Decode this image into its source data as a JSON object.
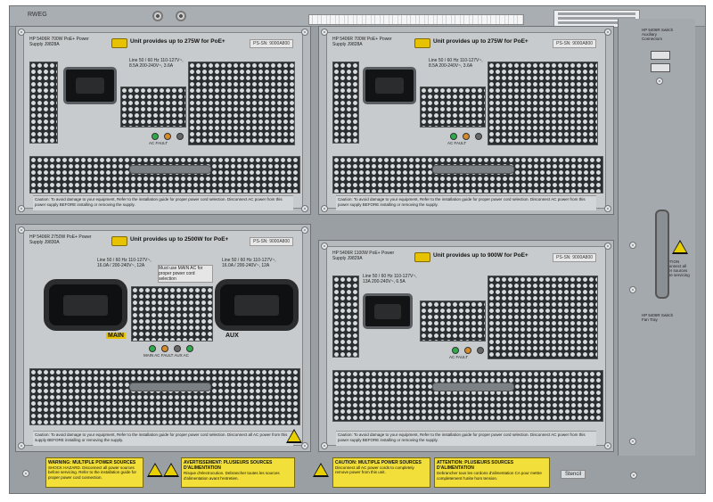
{
  "chassis": {
    "model": "RWEG",
    "brand_tag": "Stencil"
  },
  "psu1": {
    "title": "HP 5406R 700W PoE+ Power Supply J9828A",
    "note": "Unit provides up to 275W for PoE+",
    "part": "PS-SN: 9000A800",
    "rating": "Line 50 / 60 Hz 110-127V~, 8.5A 200-240V~, 3.6A",
    "led_labels": "AC   FAULT",
    "caution": "Caution: To avoid damage to your equipment, Refer to the installation guide for proper power cord selection. Disconnect AC power from this power supply BEFORE installing or removing the supply."
  },
  "psu2": {
    "title": "HP 5406R 700W PoE+ Power Supply J9828A",
    "note": "Unit provides up to 275W for PoE+",
    "part": "PS-SN: 9000A800",
    "rating": "Line 50 / 60 Hz 110-127V~, 8.5A 200-240V~, 3.6A",
    "led_labels": "AC   FAULT",
    "caution": "Caution: To avoid damage to your equipment, Refer to the installation guide for proper power cord selection. Disconnect AC power from this power supply BEFORE installing or removing the supply."
  },
  "psu3": {
    "title": "HP 5406R 2750W PoE+ Power Supply J9830A",
    "note": "Unit provides up to 2500W for PoE+",
    "part": "PS-SN: 9000A800",
    "rating_main": "Line 50 / 60 Hz 110-127V~, 16.0A / 200-240V~, 12A",
    "rating_aux": "Line 50 / 60 Hz 110-127V~, 16.0A / 200-240V~, 12A",
    "aux_note": "Must use MAIN AC for proper power cord selection",
    "main_label": "MAIN",
    "aux_label": "AUX",
    "led_labels": "MAIN AC   FAULT   AUX AC",
    "caution": "Caution: To avoid damage to your equipment, Refer to the installation guide for proper power cord selection. Disconnect all AC power from this supply BEFORE installing or removing the supply."
  },
  "psu4": {
    "title": "HP 5406R 1100W PoE+ Power Supply J9829A",
    "note": "Unit provides up to 900W for PoE+",
    "part": "PS-SN: 9000A800",
    "rating": "Line 50 / 60 Hz 110-127V~, 13A 200-240V~, 6.5A",
    "led_labels": "AC   FAULT",
    "caution": "Caution: To avoid damage to your equipment, Refer to the installation guide for proper power cord selection. Disconnect AC power from this power supply BEFORE installing or removing the supply."
  },
  "side": {
    "top_label": "HP 5406R Switch Auxiliary Connectors",
    "mid_label": "HP 5406R Switch Fan Tray",
    "caution_label": "CAUTION Disconnect all power sources before servicing"
  },
  "warnings": {
    "w1_title": "WARNING: MULTIPLE POWER SOURCES",
    "w1_text": "SHOCK HAZARD. Disconnect all power sources before servicing. Refer to the installation guide for proper power cord connection.",
    "w2_title": "AVERTISSEMENT: PLUSIEURS SOURCES D'ALIMENTATION",
    "w2_text": "Risque d'electrocution. Debrancher toutes les sources d'alimentation avant l'entretien.",
    "w3_title": "CAUTION: MULTIPLE POWER SOURCES",
    "w3_text": "Disconnect all AC power cords to completely remove power from this unit.",
    "w4_title": "ATTENTION: PLUSIEURS SOURCES D'ALIMENTATION",
    "w4_text": "Debrancher tous les cordons d'alimentation CA pour mettre completement l'unite hors tension."
  }
}
